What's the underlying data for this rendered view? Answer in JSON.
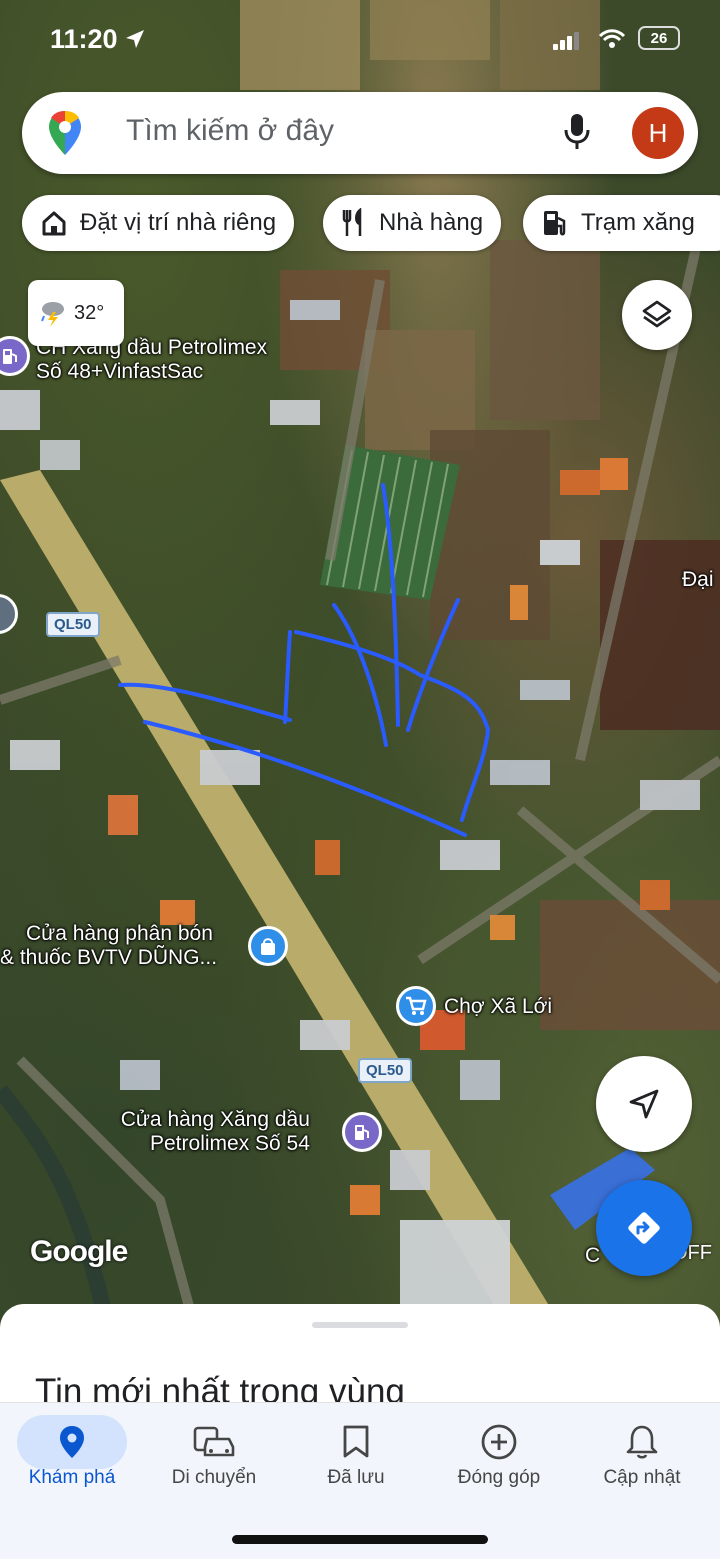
{
  "status_bar": {
    "time": "11:20",
    "battery": "26"
  },
  "search": {
    "placeholder": "Tìm kiếm ở đây",
    "avatar_letter": "H"
  },
  "chips": [
    {
      "label": "Đặt vị trí nhà riêng",
      "icon": "home-icon"
    },
    {
      "label": "Nhà hàng",
      "icon": "restaurant-icon"
    },
    {
      "label": "Trạm xăng",
      "icon": "gas-station-icon"
    }
  ],
  "weather": {
    "temp": "32°",
    "icon": "thunderstorm-icon"
  },
  "map": {
    "road_labels": [
      "QL50",
      "QL50"
    ],
    "places": {
      "petrolimex_48": [
        "CH Xăng dầu Petrolimex",
        "Số 48+VinfastSac"
      ],
      "fertilizer_shop": [
        "Cửa hàng phân bón",
        "& thuốc BVTV DŨNG..."
      ],
      "market": "Chợ Xã Lới",
      "petrolimex_54": [
        "Cửa hàng Xăng dầu",
        "Petrolimex Số 54"
      ],
      "dai": "Đại",
      "truncated_right": "C",
      "off": "OFF"
    },
    "attribution": "Google"
  },
  "sheet": {
    "title": "Tin mới nhất trong vùng"
  },
  "nav": [
    {
      "label": "Khám phá",
      "icon": "explore-pin-icon",
      "active": true
    },
    {
      "label": "Di chuyển",
      "icon": "commute-icon",
      "active": false
    },
    {
      "label": "Đã lưu",
      "icon": "bookmark-icon",
      "active": false
    },
    {
      "label": "Đóng góp",
      "icon": "add-circle-icon",
      "active": false
    },
    {
      "label": "Cập nhật",
      "icon": "bell-icon",
      "active": false
    }
  ],
  "colors": {
    "accent": "#1a73e8",
    "avatar": "#c43a16",
    "annotation": "#2a5bff",
    "road": "#b9ac6a"
  }
}
